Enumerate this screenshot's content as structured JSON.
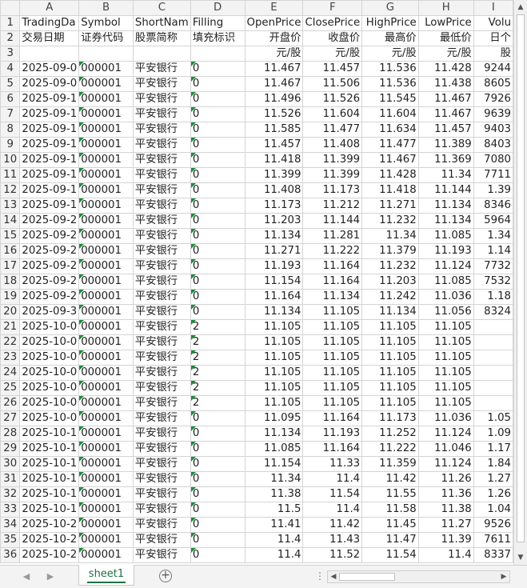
{
  "columns": [
    "A",
    "B",
    "C",
    "D",
    "E",
    "F",
    "G",
    "H",
    "I"
  ],
  "header_rows": [
    [
      "TradingDa",
      "Symbol",
      "ShortNam",
      "Filling",
      "OpenPrice",
      "ClosePrice",
      "HighPrice",
      "LowPrice",
      "Volu"
    ],
    [
      "交易日期",
      "证券代码",
      "股票简称",
      "填充标识",
      "开盘价",
      "收盘价",
      "最高价",
      "最低价",
      "日个"
    ],
    [
      "",
      "",
      "",
      "",
      "元/股",
      "元/股",
      "元/股",
      "元/股",
      "股"
    ]
  ],
  "data_rows": [
    [
      "2025-09-0",
      "000001",
      "平安银行",
      "0",
      "11.467",
      "11.457",
      "11.536",
      "11.428",
      "9244"
    ],
    [
      "2025-09-0",
      "000001",
      "平安银行",
      "0",
      "11.467",
      "11.506",
      "11.536",
      "11.438",
      "8605"
    ],
    [
      "2025-09-1",
      "000001",
      "平安银行",
      "0",
      "11.496",
      "11.526",
      "11.545",
      "11.467",
      "7926"
    ],
    [
      "2025-09-1",
      "000001",
      "平安银行",
      "0",
      "11.526",
      "11.604",
      "11.604",
      "11.467",
      "9639"
    ],
    [
      "2025-09-1",
      "000001",
      "平安银行",
      "0",
      "11.585",
      "11.477",
      "11.634",
      "11.457",
      "9403"
    ],
    [
      "2025-09-1",
      "000001",
      "平安银行",
      "0",
      "11.457",
      "11.408",
      "11.477",
      "11.389",
      "8403"
    ],
    [
      "2025-09-1",
      "000001",
      "平安银行",
      "0",
      "11.418",
      "11.399",
      "11.467",
      "11.369",
      "7080"
    ],
    [
      "2025-09-1",
      "000001",
      "平安银行",
      "0",
      "11.399",
      "11.399",
      "11.428",
      "11.34",
      "7711"
    ],
    [
      "2025-09-1",
      "000001",
      "平安银行",
      "0",
      "11.408",
      "11.173",
      "11.418",
      "11.144",
      "1.39"
    ],
    [
      "2025-09-1",
      "000001",
      "平安银行",
      "0",
      "11.173",
      "11.212",
      "11.271",
      "11.134",
      "8346"
    ],
    [
      "2025-09-2",
      "000001",
      "平安银行",
      "0",
      "11.203",
      "11.144",
      "11.232",
      "11.134",
      "5964"
    ],
    [
      "2025-09-2",
      "000001",
      "平安银行",
      "0",
      "11.134",
      "11.281",
      "11.34",
      "11.085",
      "1.34"
    ],
    [
      "2025-09-2",
      "000001",
      "平安银行",
      "0",
      "11.271",
      "11.222",
      "11.379",
      "11.193",
      "1.14"
    ],
    [
      "2025-09-2",
      "000001",
      "平安银行",
      "0",
      "11.193",
      "11.164",
      "11.232",
      "11.124",
      "7732"
    ],
    [
      "2025-09-2",
      "000001",
      "平安银行",
      "0",
      "11.154",
      "11.164",
      "11.203",
      "11.085",
      "7532"
    ],
    [
      "2025-09-2",
      "000001",
      "平安银行",
      "0",
      "11.164",
      "11.134",
      "11.242",
      "11.036",
      "1.18"
    ],
    [
      "2025-09-3",
      "000001",
      "平安银行",
      "0",
      "11.134",
      "11.105",
      "11.134",
      "11.056",
      "8324"
    ],
    [
      "2025-10-0",
      "000001",
      "平安银行",
      "2",
      "11.105",
      "11.105",
      "11.105",
      "11.105",
      ""
    ],
    [
      "2025-10-0",
      "000001",
      "平安银行",
      "2",
      "11.105",
      "11.105",
      "11.105",
      "11.105",
      ""
    ],
    [
      "2025-10-0",
      "000001",
      "平安银行",
      "2",
      "11.105",
      "11.105",
      "11.105",
      "11.105",
      ""
    ],
    [
      "2025-10-0",
      "000001",
      "平安银行",
      "2",
      "11.105",
      "11.105",
      "11.105",
      "11.105",
      ""
    ],
    [
      "2025-10-0",
      "000001",
      "平安银行",
      "2",
      "11.105",
      "11.105",
      "11.105",
      "11.105",
      ""
    ],
    [
      "2025-10-0",
      "000001",
      "平安银行",
      "2",
      "11.105",
      "11.105",
      "11.105",
      "11.105",
      ""
    ],
    [
      "2025-10-0",
      "000001",
      "平安银行",
      "0",
      "11.095",
      "11.164",
      "11.173",
      "11.036",
      "1.05"
    ],
    [
      "2025-10-1",
      "000001",
      "平安银行",
      "0",
      "11.134",
      "11.193",
      "11.252",
      "11.124",
      "1.09"
    ],
    [
      "2025-10-1",
      "000001",
      "平安银行",
      "0",
      "11.085",
      "11.164",
      "11.222",
      "11.046",
      "1.17"
    ],
    [
      "2025-10-1",
      "000001",
      "平安银行",
      "0",
      "11.154",
      "11.33",
      "11.359",
      "11.124",
      "1.84"
    ],
    [
      "2025-10-1",
      "000001",
      "平安银行",
      "0",
      "11.34",
      "11.4",
      "11.42",
      "11.26",
      "1.27"
    ],
    [
      "2025-10-1",
      "000001",
      "平安银行",
      "0",
      "11.38",
      "11.54",
      "11.55",
      "11.36",
      "1.26"
    ],
    [
      "2025-10-1",
      "000001",
      "平安银行",
      "0",
      "11.5",
      "11.4",
      "11.58",
      "11.38",
      "1.04"
    ],
    [
      "2025-10-2",
      "000001",
      "平安银行",
      "0",
      "11.41",
      "11.42",
      "11.45",
      "11.27",
      "9526"
    ],
    [
      "2025-10-2",
      "000001",
      "平安银行",
      "0",
      "11.4",
      "11.43",
      "11.47",
      "11.39",
      "7611"
    ],
    [
      "2025-10-2",
      "000001",
      "平安银行",
      "0",
      "11.4",
      "11.52",
      "11.54",
      "11.4",
      "8337"
    ]
  ],
  "footer": {
    "sheet_tab": "sheet1",
    "add_sheet_icon": "plus-circle-icon",
    "nav_prev_icon": "triangle-left-icon",
    "nav_next_icon": "triangle-right-icon"
  },
  "colors": {
    "accent": "#1e7145",
    "flag": "#1e8b3a",
    "header_bg": "#f3f3f3",
    "grid": "#d4d4d4"
  }
}
